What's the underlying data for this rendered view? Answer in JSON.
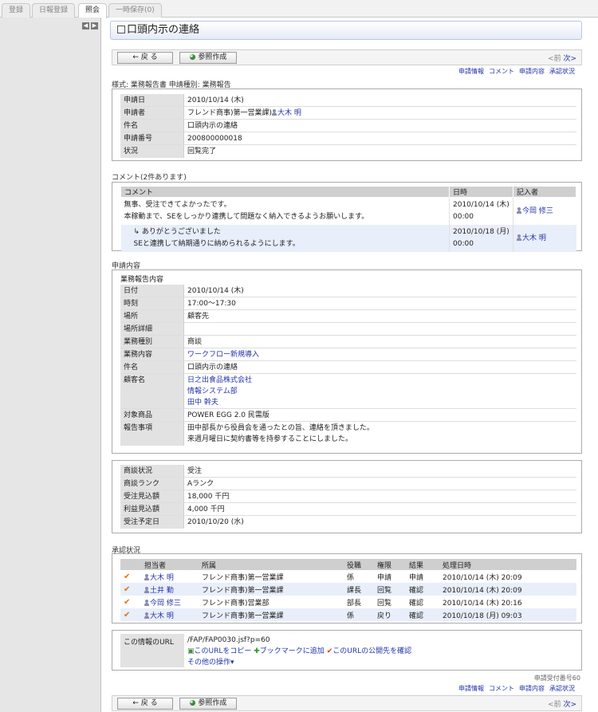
{
  "tabs": [
    "登録",
    "日報登録",
    "照会",
    "一時保存(0)"
  ],
  "page_title": "口頭内示の連絡",
  "buttons": {
    "back": "← 戻 る",
    "ref": "参照作成"
  },
  "nav": {
    "prev": "<前",
    "next": "次>"
  },
  "links": [
    "申請情報",
    "コメント",
    "申請内容",
    "承認状況"
  ],
  "form_info": "様式: 業務報告書 申請種別: 業務報告",
  "application": [
    {
      "k": "申請日",
      "v": "2010/10/14 (木)"
    },
    {
      "k": "申請者",
      "v": "フレンド商事)第一営業課)",
      "person": "大木 明"
    },
    {
      "k": "件名",
      "v": "口頭内示の連絡"
    },
    {
      "k": "申請番号",
      "v": "200800000018"
    },
    {
      "k": "状況",
      "v": "回覧完了"
    }
  ],
  "comments": {
    "title": "コメント(2件あります)",
    "headers": [
      "コメント",
      "日時",
      "記入者"
    ],
    "rows": [
      {
        "lines": [
          "無事、受注できてよかったです。",
          "本稼動まで、SEをしっかり連携して問題なく納入できるようお願いします。"
        ],
        "date": "2010/10/14 (木)",
        "time": "00:00",
        "author": "今岡 修三"
      },
      {
        "lines": [
          "↳ ありがとうございました",
          "SEと連携して納期通りに納められるようにします。"
        ],
        "date": "2010/10/18 (月)",
        "time": "00:00",
        "author": "大木 明"
      }
    ]
  },
  "content": {
    "title": "申請内容",
    "subtitle": "業務報告内容",
    "date_label": "日付",
    "date": "2010/10/14 (木)",
    "time_label": "時刻",
    "time": "17:00〜17:30",
    "place_label": "場所",
    "place": "顧客先",
    "place_detail_label": "場所詳細",
    "place_detail": "",
    "work_type_label": "業務種別",
    "work_type": "商談",
    "work_content_label": "業務内容",
    "work_content": "ワークフロー新規導入",
    "subject_label": "件名",
    "subject": "口頭内示の連絡",
    "customer_label": "顧客名",
    "customers": [
      "日之出食品株式会社",
      "情報システム部",
      "田中 幹夫"
    ],
    "product_label": "対象商品",
    "product": "POWER EGG 2.0 民需版",
    "report_label": "報告事項",
    "report": [
      "田中部長から役員会を通ったとの旨、連絡を頂きました。",
      "来週月曜日に契約書等を持参することにしました。"
    ]
  },
  "business": [
    {
      "k": "商談状況",
      "v": "受注"
    },
    {
      "k": "商談ランク",
      "v": "Aランク"
    },
    {
      "k": "受注見込額",
      "v": "18,000 千円"
    },
    {
      "k": "利益見込額",
      "v": "4,000 千円"
    },
    {
      "k": "受注予定日",
      "v": "2010/10/20 (水)"
    }
  ],
  "approval": {
    "title": "承認状況",
    "headers": [
      "担当者",
      "所属",
      "役職",
      "権限",
      "結果",
      "処理日時"
    ],
    "rows": [
      {
        "name": "大木 明",
        "dept": "フレンド商事)第一営業課",
        "role": "係",
        "auth": "申請",
        "result": "申請",
        "time": "2010/10/14 (木) 20:09"
      },
      {
        "name": "土井 勤",
        "dept": "フレンド商事)第一営業課",
        "role": "課長",
        "auth": "回覧",
        "result": "確認",
        "time": "2010/10/14 (木) 20:09"
      },
      {
        "name": "今岡 修三",
        "dept": "フレンド商事)営業部",
        "role": "部長",
        "auth": "回覧",
        "result": "確認",
        "time": "2010/10/14 (木) 20:16"
      },
      {
        "name": "大木 明",
        "dept": "フレンド商事)第一営業課",
        "role": "係",
        "auth": "戻り",
        "result": "確認",
        "time": "2010/10/18 (月) 09:03"
      }
    ]
  },
  "url_info": {
    "label": "この情報のURL",
    "url": "/FAP/FAP0030.jsf?p=60",
    "copy": "このURLをコピー",
    "bookmark": "ブックマークに追加",
    "check": "このURLの公開先を確認",
    "other": "その他の操作"
  },
  "receipt": "申請受付番号60"
}
